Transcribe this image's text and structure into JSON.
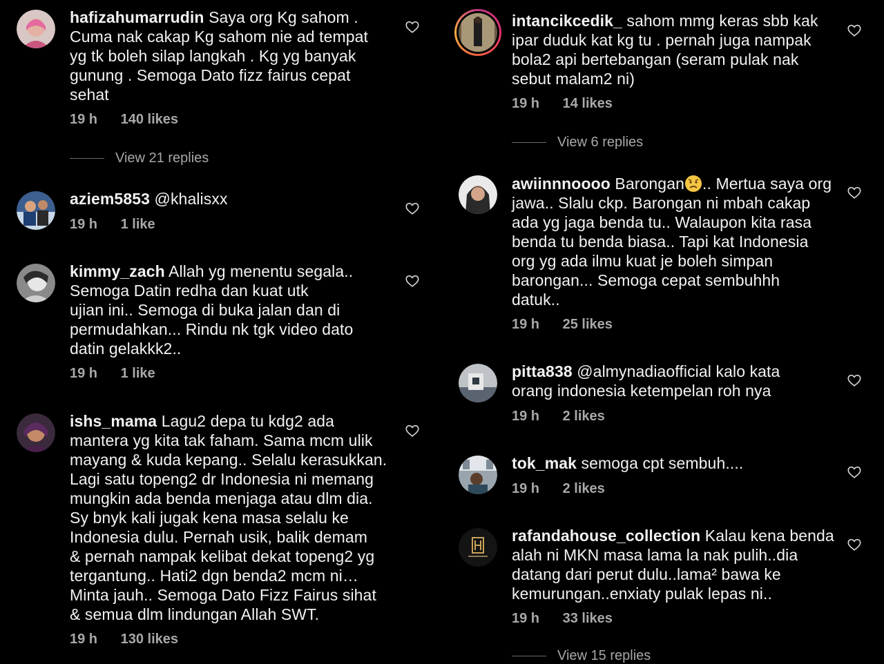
{
  "left_comments": [
    {
      "username": "hafizahumarrudin",
      "lines": [
        "Saya org Kg sahom .",
        "Cuma nak cakap Kg sahom nie ad tempat",
        "yg tk boleh silap langkah . Kg yg banyak",
        "gunung . Semoga Dato fizz fairus cepat",
        "sehat"
      ],
      "time": "19 h",
      "likes": "140 likes",
      "replies": "View 21 replies"
    },
    {
      "username": "aziem5853",
      "lines": [
        "@khalisxx"
      ],
      "time": "19 h",
      "likes": "1 like"
    },
    {
      "username": "kimmy_zach",
      "lines": [
        "Allah yg menentu segala..",
        "Semoga Datin redha dan kuat utk",
        "ujian ini.. Semoga di buka jalan dan di",
        "permudahkan... Rindu nk tgk video dato",
        "datin gelakkk2.."
      ],
      "time": "19 h",
      "likes": "1 like"
    },
    {
      "username": "ishs_mama",
      "lines": [
        "Lagu2 depa tu kdg2 ada",
        "mantera yg kita tak faham. Sama mcm ulik",
        "mayang & kuda kepang.. Selalu kerasukkan.",
        "Lagi satu topeng2 dr Indonesia ni memang",
        "mungkin ada benda menjaga atau dlm dia.",
        "Sy bnyk kali jugak kena masa selalu ke",
        "Indonesia dulu. Pernah usik, balik demam",
        "& pernah nampak kelibat dekat topeng2 yg",
        "tergantung.. Hati2 dgn benda2 mcm ni…",
        "Minta jauh.. Semoga Dato Fizz Fairus sihat",
        "& semua dlm lindungan Allah SWT."
      ],
      "time": "19 h",
      "likes": "130 likes"
    }
  ],
  "right_comments": [
    {
      "username": "intancikcedik_",
      "lines": [
        "sahom mmg keras sbb kak",
        "ipar duduk kat kg tu . pernah juga nampak",
        "bola2 api bertebangan (seram pulak nak",
        "sebut malam2 ni)"
      ],
      "time": "19 h",
      "likes": "14 likes",
      "replies": "View 6 replies"
    },
    {
      "username": "awiinnnoooo",
      "lines_first_before_emoji": "Barongan",
      "lines_first_after_emoji": ".. Mertua saya org",
      "lines": [
        "jawa.. Slalu ckp. Barongan ni mbah  cakap",
        "ada yg jaga benda tu.. Walaupon kita rasa",
        "benda tu benda biasa.. Tapi kat Indonesia",
        "org yg ada ilmu kuat je boleh simpan",
        "barongan... Semoga cepat sembuhhh",
        "datuk.."
      ],
      "time": "19 h",
      "likes": "25 likes"
    },
    {
      "username": "pitta838",
      "lines": [
        "@almynadiaofficial kalo kata",
        "orang indonesia ketempelan roh nya"
      ],
      "time": "19 h",
      "likes": "2 likes"
    },
    {
      "username": "tok_mak",
      "lines": [
        "semoga cpt sembuh...."
      ],
      "time": "19 h",
      "likes": "2 likes"
    },
    {
      "username": "rafandahouse_collection",
      "lines": [
        "Kalau kena benda",
        "alah ni MKN masa lama la nak pulih..dia",
        "datang dari perut dulu..lama² bawa ke",
        "kemurungan..enxiaty pulak lepas ni.."
      ],
      "time": "19 h",
      "likes": "33 likes",
      "replies": "View 15 replies"
    }
  ],
  "colors": {
    "background": "#000000",
    "text": "#f2f2f2",
    "muted": "#a8a8a8"
  },
  "icons": {
    "like": "heart-outline-icon",
    "emoji": "worried-face-emoji"
  }
}
